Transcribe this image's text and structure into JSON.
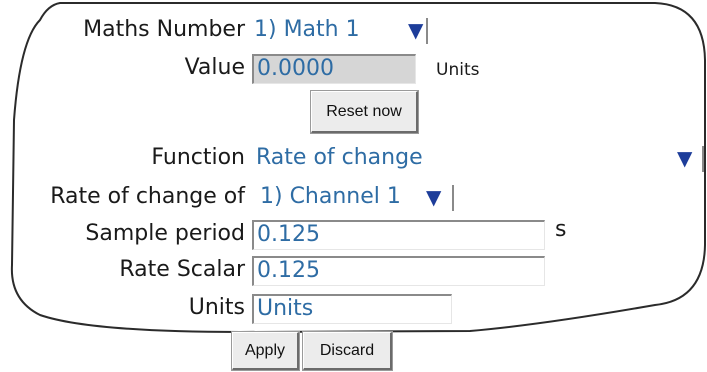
{
  "form": {
    "maths_number": {
      "label": "Maths Number",
      "value": "1) Math 1"
    },
    "value": {
      "label": "Value",
      "value": "0.0000",
      "units": "Units"
    },
    "reset_button": "Reset now",
    "function": {
      "label": "Function",
      "value": "Rate of change"
    },
    "rate_of_change_of": {
      "label": "Rate of change of",
      "value": "1) Channel 1"
    },
    "sample_period": {
      "label": "Sample period",
      "value": "0.125",
      "unit": "s"
    },
    "rate_scalar": {
      "label": "Rate Scalar",
      "value": "0.125"
    },
    "units": {
      "label": "Units",
      "value": "Units"
    }
  },
  "actions": {
    "apply": "Apply",
    "discard": "Discard"
  },
  "icons": {
    "dropdown_arrow": "▼"
  },
  "colors": {
    "value_text": "#2e6ca4",
    "arrow": "#1d3d9a",
    "readonly_bg": "#d6d6d6"
  }
}
